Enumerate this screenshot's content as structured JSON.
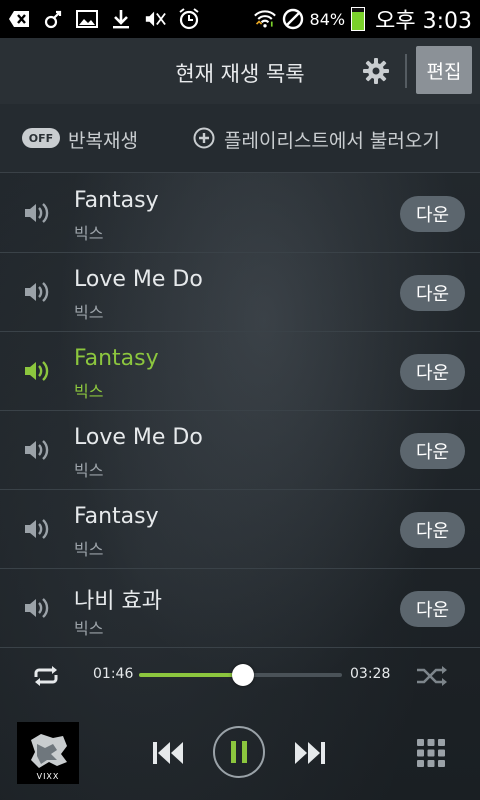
{
  "status_bar": {
    "battery_text": "84%",
    "battery_level": 0.84,
    "time": "오후 3:03",
    "icons": [
      "add-box-icon",
      "bluetooth-icon",
      "image-icon",
      "download-icon",
      "mute-icon",
      "alarm-icon",
      "wifi-icon",
      "block-icon"
    ]
  },
  "header": {
    "title": "현재 재생 목록",
    "edit_label": "편집"
  },
  "options": {
    "repeat_toggle": "OFF",
    "repeat_label": "반복재생",
    "add_from_playlist": "플레이리스트에서 불러오기"
  },
  "tracks": [
    {
      "title": "Fantasy",
      "artist": "빅스",
      "action": "다운",
      "playing": false
    },
    {
      "title": "Love Me Do",
      "artist": "빅스",
      "action": "다운",
      "playing": false
    },
    {
      "title": "Fantasy",
      "artist": "빅스",
      "action": "다운",
      "playing": true
    },
    {
      "title": "Love Me Do",
      "artist": "빅스",
      "action": "다운",
      "playing": false
    },
    {
      "title": "Fantasy",
      "artist": "빅스",
      "action": "다운",
      "playing": false
    },
    {
      "title": "나비 효과",
      "artist": "빅스",
      "action": "다운",
      "playing": false
    }
  ],
  "player": {
    "current_time": "01:46",
    "total_time": "03:28",
    "progress": 0.51,
    "album_text": "VIXX"
  },
  "colors": {
    "accent": "#8cc63e",
    "button_bg": "#5c666e"
  }
}
